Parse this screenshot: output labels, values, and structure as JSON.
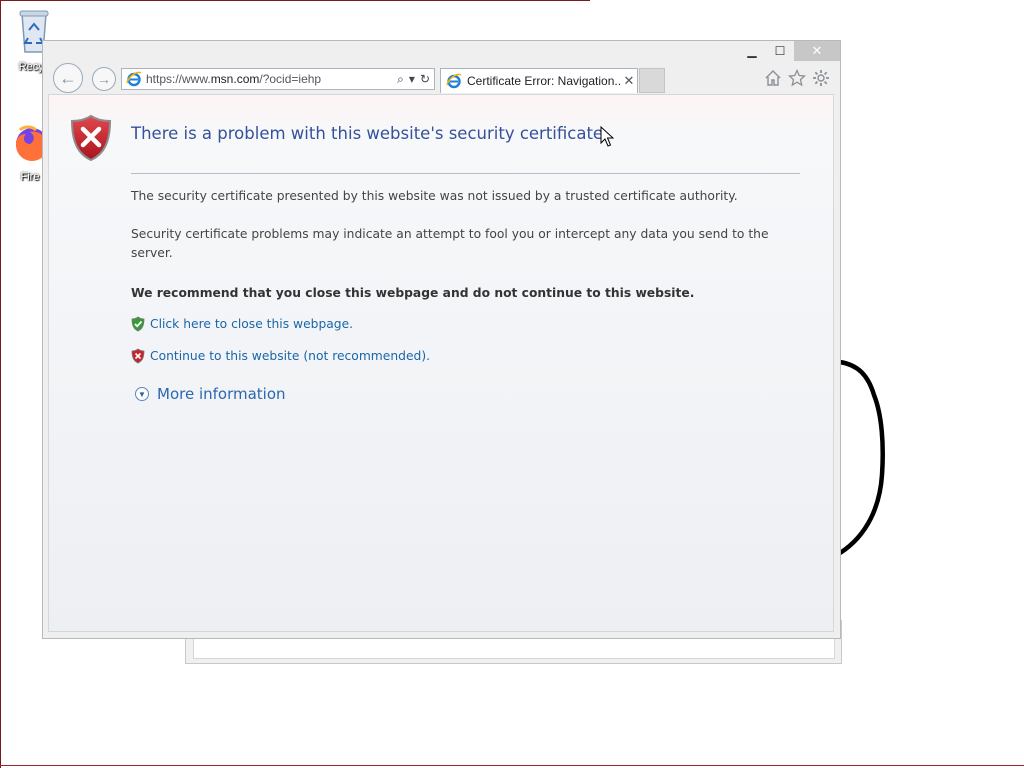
{
  "desktop": {
    "icons": [
      {
        "label": "Recyc",
        "icon": "recycle-bin-icon"
      },
      {
        "label": "Fire",
        "icon": "firefox-icon"
      }
    ]
  },
  "browser": {
    "address_url_prefix": "https://www.",
    "address_url_domain": "msn.com",
    "address_url_suffix": "/?ocid=iehp",
    "search_glyph": "⌕",
    "dropdown_glyph": "▾",
    "refresh_glyph": "↻",
    "tab_title": "Certificate Error: Navigation...",
    "tab_close": "✕",
    "window_controls": {
      "minimize": "▁",
      "maximize": "☐",
      "close": "✕"
    },
    "toolbar_icons": [
      "home-icon",
      "favorites-star-icon",
      "settings-gear-icon"
    ]
  },
  "page": {
    "title": "There is a problem with this website's security certificate.",
    "para1": "The security certificate presented by this website was not issued by a trusted certificate authority.",
    "para2": "Security certificate problems may indicate an attempt to fool you or intercept any data you send to the server.",
    "recommendation": "We recommend that you close this webpage and do not continue to this website.",
    "close_link": "Click here to close this webpage.",
    "continue_link": "Continue to this website (not recommended).",
    "more_info": "More information"
  },
  "colors": {
    "title": "#35519b",
    "link": "#1a66a8",
    "shield_red": "#c8232c",
    "shield_green": "#3a9a3a"
  }
}
